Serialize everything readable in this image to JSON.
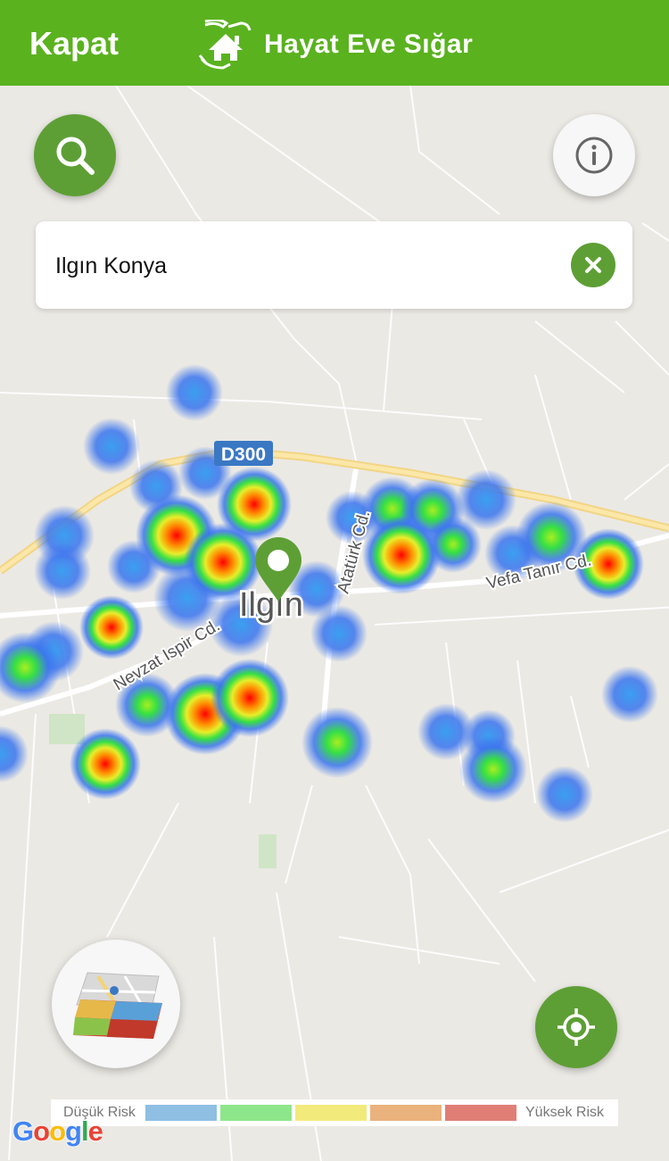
{
  "header": {
    "close_label": "Kapat",
    "app_title": "Hayat Eve Sığar",
    "bg_color": "#5ab21f"
  },
  "search": {
    "value": "Ilgın Konya",
    "search_icon": "search-icon",
    "clear_icon": "close-icon"
  },
  "buttons": {
    "info_icon": "info-icon",
    "layers_icon": "map-layers-icon",
    "locate_icon": "my-location-icon",
    "accent_color": "#5d9f35"
  },
  "map": {
    "city_label": "Ilgın",
    "road_badge": "D300",
    "streets": [
      "Atatürk Cd.",
      "Vefa Tanır Cd.",
      "Nevzat Ispir Cd."
    ],
    "marker_icon": "location-pin-icon"
  },
  "legend": {
    "low_label": "Düşük Risk",
    "high_label": "Yüksek Risk",
    "colors": [
      "#8fbfe3",
      "#8ee68a",
      "#f3ea7c",
      "#eab27c",
      "#e07e76"
    ]
  },
  "attribution": {
    "text": "Google"
  }
}
